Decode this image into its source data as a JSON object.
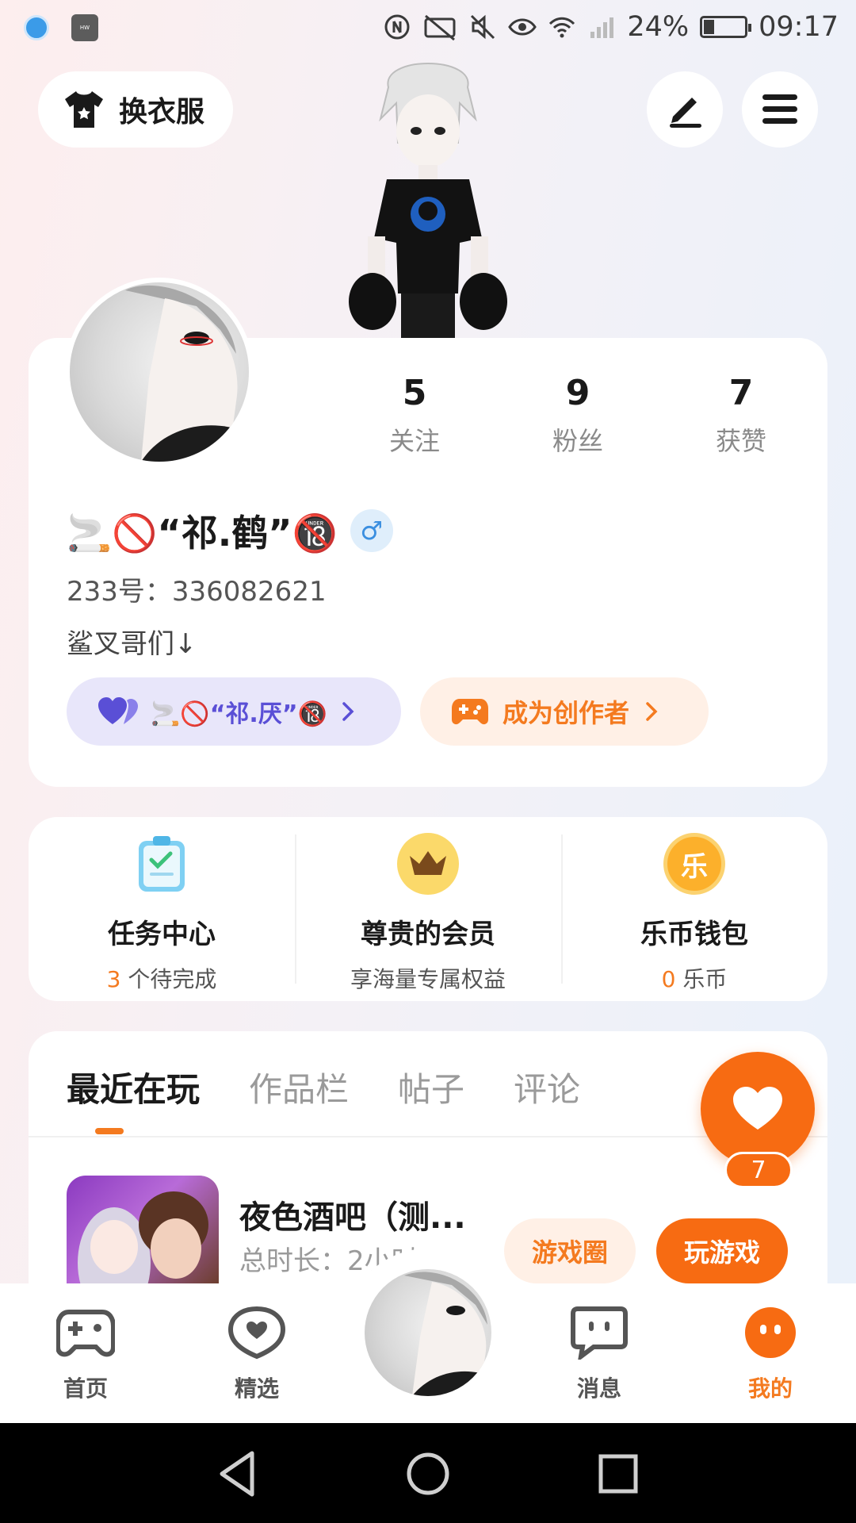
{
  "status_bar": {
    "battery": "24%",
    "battery_level": 0.24,
    "time": "09:17"
  },
  "header": {
    "outfit_label": "换衣服"
  },
  "profile": {
    "stats": [
      {
        "num": "5",
        "label": "关注"
      },
      {
        "num": "9",
        "label": "粉丝"
      },
      {
        "num": "7",
        "label": "获赞"
      }
    ],
    "nickname": "🚬🚫“祁.鹤”🔞",
    "gender_symbol": "♂",
    "uid": "233号：336082621",
    "bio": "鲨叉哥们↓",
    "fan_pill_label": "🚬🚫“祁.厌”🔞",
    "creator_label": "成为创作者"
  },
  "features": [
    {
      "title": "任务中心",
      "sub_highlight": "3",
      "sub_text": " 个待完成"
    },
    {
      "title": "尊贵的会员",
      "sub_highlight": "",
      "sub_text": "享海量专属权益"
    },
    {
      "title": "乐币钱包",
      "sub_highlight": "0",
      "sub_text": " 乐币",
      "icon_char": "乐"
    }
  ],
  "tabs": [
    "最近在玩",
    "作品栏",
    "帖子",
    "评论"
  ],
  "recent_game": {
    "name": "夜色酒吧（测...",
    "time": "总时长：2小时",
    "circle_label": "游戏圈",
    "play_label": "玩游戏"
  },
  "like_count": "7",
  "bottom_nav": [
    {
      "label": "首页",
      "icon": "gamepad-icon"
    },
    {
      "label": "精选",
      "icon": "heart-chat-icon"
    },
    {
      "label": "消息",
      "icon": "message-icon"
    },
    {
      "label": "我的",
      "icon": "me-icon"
    }
  ],
  "colors": {
    "accent": "#f47a1f",
    "fab": "#f76b12",
    "fan_pill_bg": "#e8e6fa",
    "fan_pill_text": "#5a4fd6"
  }
}
